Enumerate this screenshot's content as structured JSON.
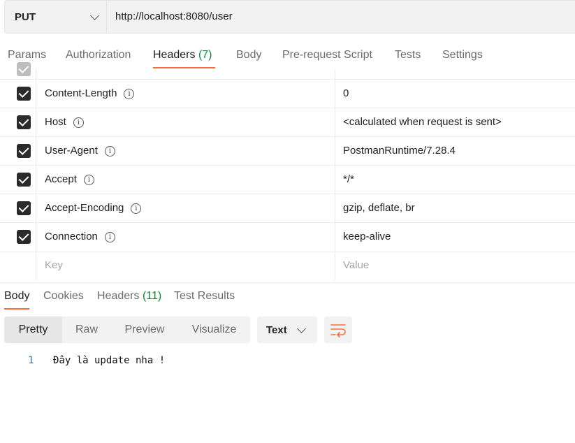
{
  "request": {
    "method": "PUT",
    "url": "http://localhost:8080/user"
  },
  "request_tabs": [
    {
      "label": "Params"
    },
    {
      "label": "Authorization"
    },
    {
      "label": "Headers",
      "count": "(7)"
    },
    {
      "label": "Body"
    },
    {
      "label": "Pre-request Script"
    },
    {
      "label": "Tests"
    },
    {
      "label": "Settings"
    }
  ],
  "headers": [
    {
      "key": "Content-Length",
      "value": "0"
    },
    {
      "key": "Host",
      "value": "<calculated when request is sent>"
    },
    {
      "key": "User-Agent",
      "value": "PostmanRuntime/7.28.4"
    },
    {
      "key": "Accept",
      "value": "*/*"
    },
    {
      "key": "Accept-Encoding",
      "value": "gzip, deflate, br"
    },
    {
      "key": "Connection",
      "value": "keep-alive"
    }
  ],
  "new_row": {
    "key_placeholder": "Key",
    "value_placeholder": "Value"
  },
  "response_tabs": [
    {
      "label": "Body"
    },
    {
      "label": "Cookies"
    },
    {
      "label": "Headers",
      "count": "(11)"
    },
    {
      "label": "Test Results"
    }
  ],
  "view_modes": [
    "Pretty",
    "Raw",
    "Preview",
    "Visualize"
  ],
  "format": "Text",
  "body_lines": [
    {
      "num": "1",
      "text": "Đây là update nha !"
    }
  ],
  "colors": {
    "accent": "#ff6c37",
    "count_green": "#0b8a3a"
  }
}
